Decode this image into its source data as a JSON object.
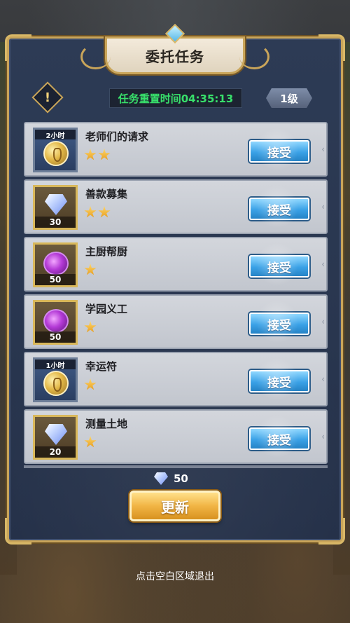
{
  "title": "委托任务",
  "timer_text": "任务重置时间04:35:13",
  "level_text": "1级",
  "info_icon_text": "!",
  "quests": [
    {
      "name": "老师们的请求",
      "stars": 2,
      "icon": "coin-icon",
      "time_tag": "2小时",
      "qty": "",
      "button": "接受"
    },
    {
      "name": "善款募集",
      "stars": 2,
      "icon": "diamond-icon",
      "time_tag": "",
      "qty": "30",
      "button": "接受"
    },
    {
      "name": "主厨帮厨",
      "stars": 1,
      "icon": "gem-icon",
      "time_tag": "",
      "qty": "50",
      "button": "接受"
    },
    {
      "name": "学园义工",
      "stars": 1,
      "icon": "gem-icon",
      "time_tag": "",
      "qty": "50",
      "button": "接受"
    },
    {
      "name": "幸运符",
      "stars": 1,
      "icon": "coin-icon",
      "time_tag": "1小时",
      "qty": "",
      "button": "接受"
    },
    {
      "name": "测量土地",
      "stars": 1,
      "icon": "diamond-icon",
      "time_tag": "",
      "qty": "20",
      "button": "接受"
    }
  ],
  "refresh_cost": "50",
  "refresh_label": "更新",
  "exit_hint": "点击空白区域退出",
  "colors": {
    "accent_gold": "#c9a55a",
    "timer_green": "#38e06b",
    "accept_blue": "#3aa1e6"
  }
}
